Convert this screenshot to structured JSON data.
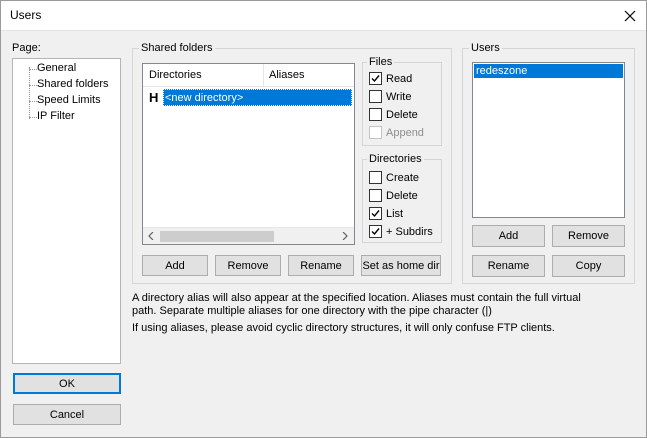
{
  "window": {
    "title": "Users"
  },
  "page_panel": {
    "label": "Page:",
    "items": [
      "General",
      "Shared folders",
      "Speed Limits",
      "IP Filter"
    ],
    "selected": "Shared folders"
  },
  "shared_folders": {
    "group_label": "Shared folders",
    "columns": [
      "Directories",
      "Aliases"
    ],
    "rows": [
      {
        "flag": "H",
        "directory": "<new directory>",
        "alias": ""
      }
    ],
    "buttons": {
      "add": "Add",
      "remove": "Remove",
      "rename": "Rename",
      "set_home": "Set as home dir"
    }
  },
  "files": {
    "label": "Files",
    "options": [
      {
        "label": "Read",
        "checked": true,
        "enabled": true
      },
      {
        "label": "Write",
        "checked": false,
        "enabled": true
      },
      {
        "label": "Delete",
        "checked": false,
        "enabled": true
      },
      {
        "label": "Append",
        "checked": false,
        "enabled": false
      }
    ]
  },
  "directories": {
    "label": "Directories",
    "options": [
      {
        "label": "Create",
        "checked": false
      },
      {
        "label": "Delete",
        "checked": false
      },
      {
        "label": "List",
        "checked": true
      },
      {
        "label": "+ Subdirs",
        "checked": true
      }
    ]
  },
  "users": {
    "label": "Users",
    "items": [
      "redeszone"
    ],
    "selected": "redeszone",
    "buttons": {
      "add": "Add",
      "remove": "Remove",
      "rename": "Rename",
      "copy": "Copy"
    }
  },
  "info": {
    "line1": "A directory alias will also appear at the specified location. Aliases must contain the full virtual",
    "line2": "path. Separate multiple aliases for one directory with the pipe character (|)",
    "line3": "If using aliases, please avoid cyclic directory structures, it will only confuse FTP clients."
  },
  "footer": {
    "ok": "OK",
    "cancel": "Cancel"
  },
  "colors": {
    "selection": "#0078d7",
    "focus_border": "#0078d7"
  }
}
